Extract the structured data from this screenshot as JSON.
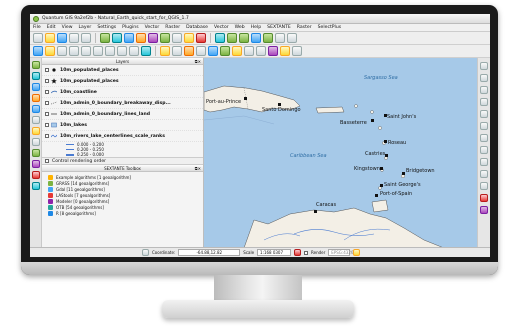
{
  "window": {
    "title": "Quantum GIS 9a2ef2b - Natural_Earth_quick_start_for_QGIS_1.7"
  },
  "menu": [
    "File",
    "Edit",
    "View",
    "Layer",
    "Settings",
    "Plugins",
    "Vector",
    "Raster",
    "Database",
    "Vector",
    "Web",
    "Help",
    "SEXTANTE",
    "Raster",
    "SelectPlus"
  ],
  "layers_panel": {
    "title": "Layers",
    "layers": [
      {
        "name": "10m_populated_places"
      },
      {
        "name": "10m_populated_places"
      },
      {
        "name": "10m_coastline"
      },
      {
        "name": "10m_admin_0_boundary_breakaway_disp..."
      },
      {
        "name": "10m_admin_0_boundary_lines_land"
      },
      {
        "name": "10m_lakes"
      },
      {
        "name": "10m_rivers_lake_centerlines_scale_ranks"
      }
    ],
    "legend": [
      "0.000 - 0.200",
      "0.200 - 0.250",
      "0.250 - 0.000"
    ]
  },
  "render_order": "Control rendering order",
  "toolbox": {
    "title": "SEXTANTE Toolbox",
    "items": [
      "Example algorithms [1 geoalgorithm]",
      "GRASS [14 geoalgorithms]",
      "Gdal [11 geoalgorithms]",
      "LAStools [7 geoalgorithms]",
      "Modeler [0 geoalgorithms]",
      "OTB [54 geoalgorithms]",
      "R [8 geoalgorithms]"
    ]
  },
  "map": {
    "seas": [
      "Sargasso Sea",
      "Caribbean Sea"
    ],
    "places": [
      "Port-au-Prince",
      "Santo Domingo",
      "Basseterre",
      "Saint John's",
      "Roseau",
      "Castries",
      "Kingstown",
      "Bridgetown",
      "Saint George's",
      "Port-of-Spain",
      "Caracas"
    ],
    "colors": {
      "water": "#a6c9e8",
      "land": "#f3efe6"
    }
  },
  "statusbar": {
    "coordinate_label": "Coordinate:",
    "coordinate_value": "-64.88,12.82",
    "scale_label": "Scale",
    "scale_value": "1:168 0307",
    "render_label": "Render",
    "epsg": "EPSG:4326"
  }
}
